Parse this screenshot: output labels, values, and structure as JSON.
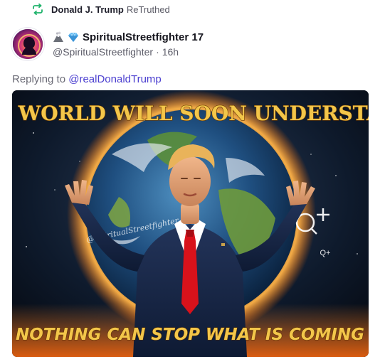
{
  "retruth": {
    "icon": "retruth-arrows-icon",
    "name": "Donald J. Trump",
    "verb": "ReTruthed",
    "accent": "#1fb36b"
  },
  "post": {
    "author": {
      "display_name": "SpiritualStreetfighter 17",
      "handle": "@SpiritualStreetfighter",
      "time": "16h",
      "separator": "·",
      "badges": [
        "volcano-emoji-icon",
        "diamond-emoji-icon"
      ]
    },
    "reply": {
      "prefix": "Replying to",
      "mention": "@realDonaldTrump",
      "mention_color": "#4b3fd0"
    },
    "media": {
      "top_text": "THE WORLD WILL SOON UNDERSTAND",
      "bottom_text": "NOTHING CAN STOP WHAT IS COMING",
      "watermark": "@SpiritualStreetfighter",
      "symbol": "Q+",
      "caption_color": "#f3c64a"
    }
  }
}
